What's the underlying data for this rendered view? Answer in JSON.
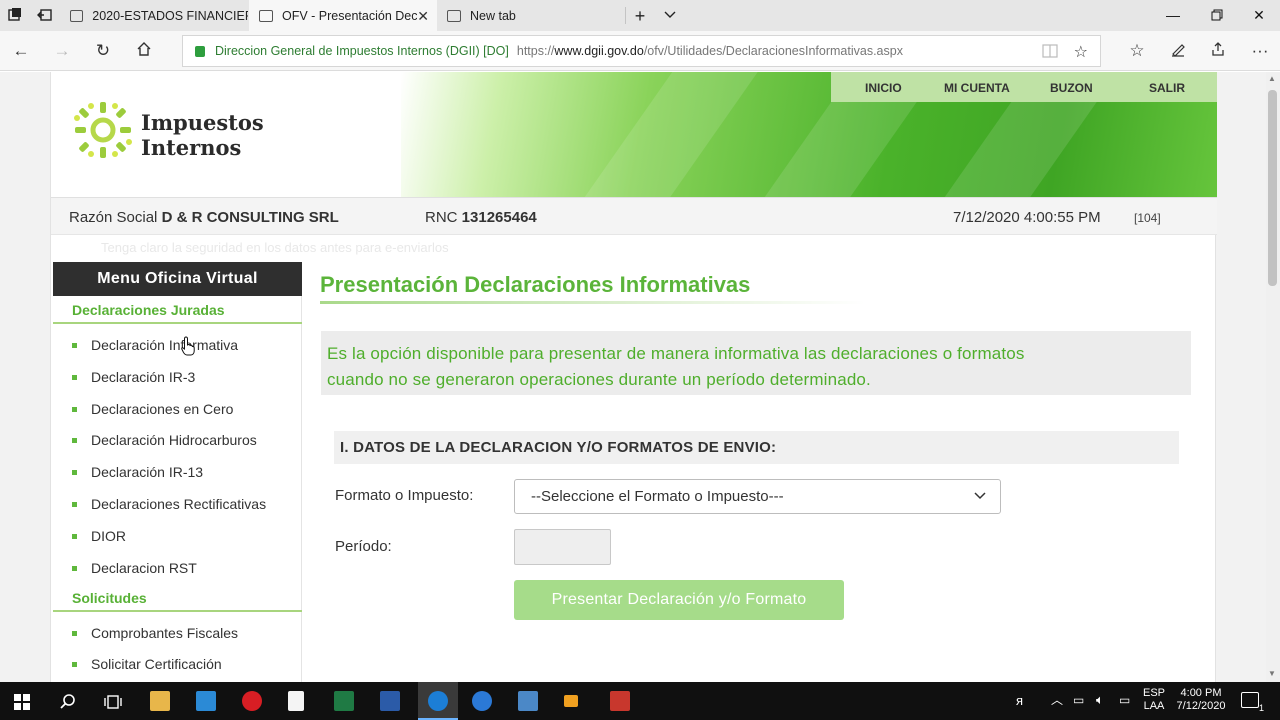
{
  "browser": {
    "tabs": [
      {
        "title": "2020-ESTADOS FINANCIER(",
        "active": false
      },
      {
        "title": "OFV - Presentación Dec",
        "active": true
      },
      {
        "title": "New tab",
        "active": false
      }
    ],
    "address": {
      "site_identity": "Direccion General de Impuestos Internos (DGII) [DO]",
      "url_prefix": "https://",
      "url_host": "www.dgii.gov.do",
      "url_path": "/ofv/Utilidades/DeclaracionesInformativas.aspx"
    }
  },
  "header": {
    "logo_line1": "Impuestos",
    "logo_line2": "Internos",
    "top_menu": [
      "INICIO",
      "MI CUENTA",
      "BUZON",
      "SALIR"
    ]
  },
  "info_bar": {
    "razon_label": "Razón Social",
    "razon_value": "D & R CONSULTING SRL",
    "rnc_label": "RNC",
    "rnc_value": "131265464",
    "datetime": "7/12/2020 4:00:55 PM",
    "code": "[104]"
  },
  "faded_notice": "Tenga claro la seguridad en los datos antes para e-enviarlos",
  "sidebar": {
    "title": "Menu Oficina Virtual",
    "sections": [
      {
        "title": "Declaraciones Juradas",
        "items": [
          "Declaración Informativa",
          "Declaración IR-3",
          "Declaraciones en Cero",
          "Declaración Hidrocarburos",
          "Declaración IR-13",
          "Declaraciones Rectificativas",
          "DIOR",
          "Declaracion RST"
        ]
      },
      {
        "title": "Solicitudes",
        "items": [
          "Comprobantes Fiscales",
          "Solicitar Certificación"
        ]
      }
    ]
  },
  "main": {
    "title": "Presentación Declaraciones Informativas",
    "description_line1": "Es la opción disponible para presentar de manera informativa las declaraciones o formatos",
    "description_line2": "cuando no se generaron operaciones durante un período determinado.",
    "section_header": "I. DATOS DE LA DECLARACION Y/O FORMATOS DE ENVIO:",
    "formato_label": "Formato o Impuesto:",
    "formato_selected": "--Seleccione el Formato o Impuesto---",
    "periodo_label": "Período:",
    "periodo_value": "",
    "submit_label": "Presentar Declaración y/o Formato"
  },
  "taskbar": {
    "lang_line1": "ESP",
    "lang_line2": "LAA",
    "time": "4:00 PM",
    "date": "7/12/2020",
    "notification_count": "1"
  },
  "colors": {
    "brand_green": "#5bb43a",
    "menu_dark": "#2f2f2f",
    "button_disabled": "#a6dc8a"
  }
}
